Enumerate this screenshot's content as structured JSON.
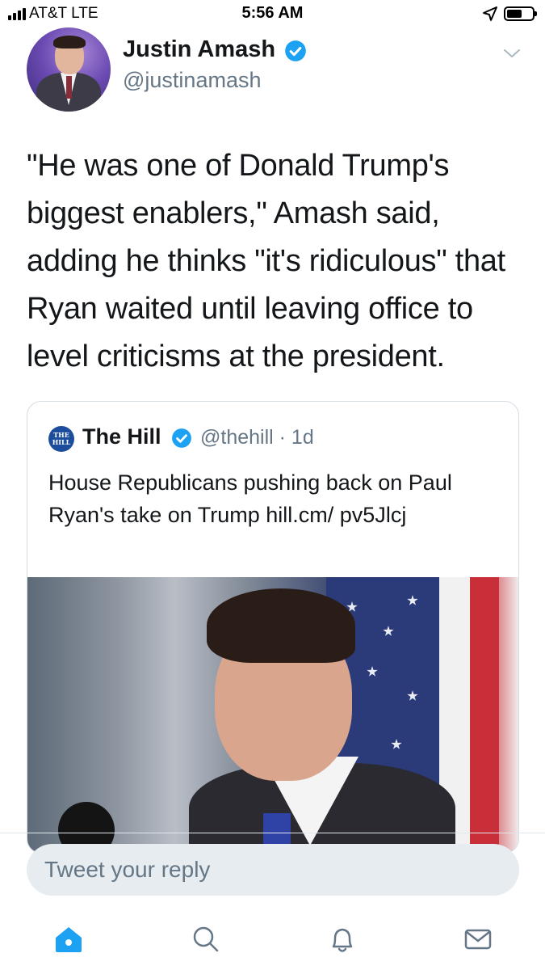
{
  "status_bar": {
    "carrier": "AT&T  LTE",
    "time": "5:56 AM"
  },
  "tweet": {
    "author_name": "Justin Amash",
    "author_handle": "@justinamash",
    "verified": true,
    "text": "\"He was one of Donald Trump's biggest enablers,\" Amash said, adding he thinks \"it's ridiculous\" that Ryan waited until leaving office to level criticisms at the president."
  },
  "quoted_tweet": {
    "logo_text": "THE HILL",
    "author_name": "The Hill",
    "author_handle_time": "@thehill · 1d",
    "verified": true,
    "text": "House Republicans pushing back on Paul Ryan's take on Trump hill.cm/ pv5Jlcj"
  },
  "reply": {
    "placeholder": "Tweet your reply"
  },
  "nav": {
    "items": [
      "home-icon",
      "search-icon",
      "notifications-icon",
      "messages-icon"
    ]
  },
  "colors": {
    "accent": "#1da1f2",
    "muted": "#657786",
    "text": "#14171a",
    "border": "#d5dce2",
    "reply_bg": "#e6ecf0"
  }
}
